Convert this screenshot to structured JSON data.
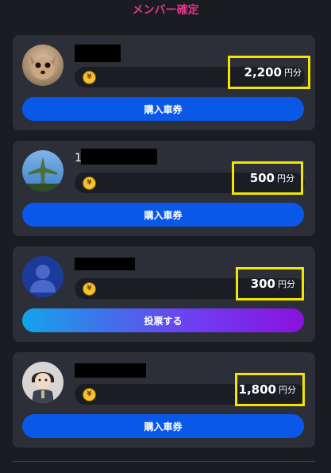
{
  "header": {
    "title": "メンバー確定"
  },
  "members": [
    {
      "name_prefix": "",
      "price": "2,200",
      "unit": "円分",
      "button": "購入車券",
      "button_style": "buy",
      "avatar": "dog-photo"
    },
    {
      "name_prefix": "1",
      "price": "500",
      "unit": "円分",
      "button": "購入車券",
      "button_style": "buy",
      "avatar": "airplane-photo"
    },
    {
      "name_prefix": "",
      "price": "300",
      "unit": "円分",
      "button": "投票する",
      "button_style": "vote",
      "avatar": "default-user-avatar"
    },
    {
      "name_prefix": "",
      "price": "1,800",
      "unit": "円分",
      "button": "購入車券",
      "button_style": "buy",
      "avatar": "illustrated-person"
    }
  ],
  "coin_glyph": "¥",
  "colors": {
    "title": "#e2378a",
    "highlight": "#f2e500",
    "buy_button": "#0a58e8",
    "card_bg": "#2c2f37",
    "page_bg": "#1a1c22"
  }
}
